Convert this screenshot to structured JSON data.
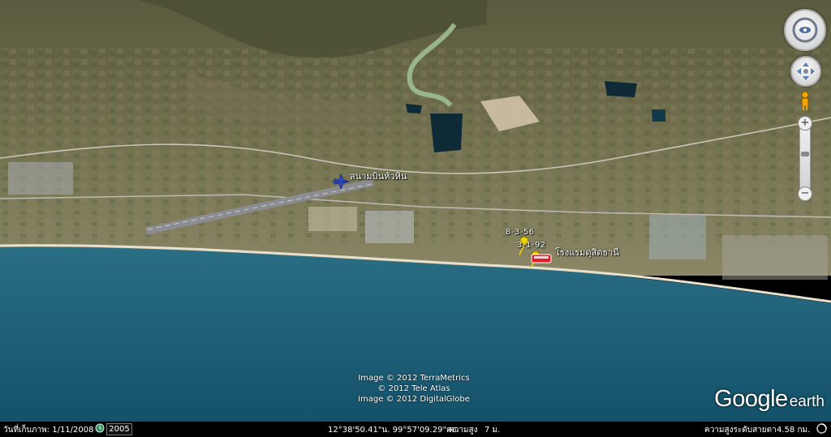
{
  "map": {
    "labels": {
      "airport": "สนามบินหัวหิน",
      "hotel": "โรงแรมดุสิตธานี",
      "marker_a": "8-3-56",
      "marker_b": "3-1-92"
    },
    "attribution": [
      "Image © 2012 TerraMetrics",
      "© 2012 Tele Atlas",
      "Image © 2012 DigitalGlobe"
    ],
    "logo": {
      "main": "Google",
      "suffix": "earth"
    }
  },
  "controls": {
    "icons": [
      "look-around-icon",
      "move-arrows-icon",
      "street-view-person-icon",
      "zoom-in-icon",
      "zoom-out-icon"
    ],
    "zoom_in": "+",
    "zoom_out": "−"
  },
  "statusbar": {
    "imagery_date_label": "วันที่เก็บภาพ: 1/11/2008",
    "historical_icon": "clock-icon",
    "year": "2005",
    "coordinates": "12°38'50.41\"น.  99°57'09.29\"ตอ.",
    "elevation_label": "ความสูง",
    "elevation_value": "7 ม.",
    "eye_alt_label": "ความสูงระดับสายตา",
    "eye_alt_value": "4.58 กม.",
    "streaming_icon": "stream-circle-icon"
  },
  "colors": {
    "sea": "#1d5f78",
    "land": "#6d6a4c",
    "statusbar": "#000000",
    "hotel_marker": "#e11d2a",
    "placemark": "#f0d400"
  }
}
